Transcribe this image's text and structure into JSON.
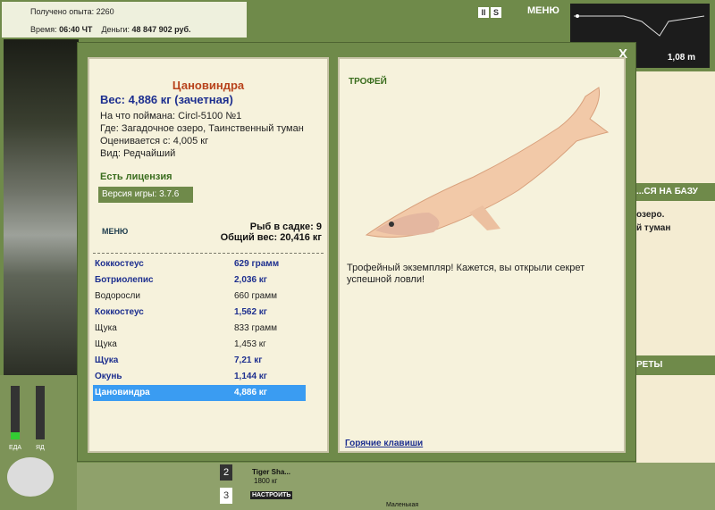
{
  "top_status": {
    "xp_label": "Получено опыта:",
    "xp_value": "2260",
    "time_label": "Время:",
    "time_value": "06:40 ЧТ",
    "money_label": "Деньги:",
    "money_value": "48 847 902 руб."
  },
  "top_controls": {
    "pause": "II",
    "s": "S",
    "menu": "МЕНЮ"
  },
  "depth": {
    "value": "1,08 m"
  },
  "right_panel": {
    "base": "...СЯ НА БАЗУ",
    "lake": "озеро.",
    "fog": "й туман",
    "secrets": "РЕТЫ"
  },
  "bottom": {
    "eat": "ЕДА",
    "poison": "ЯД",
    "n2": "2",
    "n3": "3",
    "lure": "Tiger Sha...",
    "lure_depth": "1800 кг",
    "configure": "НАСТРОИТЬ",
    "small": "Маленькая"
  },
  "dialog": {
    "close": "X",
    "fish_name": "Цановиндра",
    "weight": "Вес: 4,886 кг (зачетная)",
    "caught_with": "На что поймана: Circl-5100 №1",
    "where": "Где: Загадочное озеро, Таинственный туман",
    "value": "Оценивается с: 4,005 кг",
    "kind": "Вид: Редчайший",
    "license": "Есть лицензия",
    "version": "Версия игры: 3.7.6",
    "menu": "МЕНЮ",
    "cage_count": "Рыб в садке: 9",
    "total_weight": "Общий вес: 20,416 кг",
    "catch_list": [
      {
        "name": "Коккостеус",
        "weight": "629 грамм",
        "style": "bold"
      },
      {
        "name": "Ботриолепис",
        "weight": "2,036 кг",
        "style": "bold"
      },
      {
        "name": "Водоросли",
        "weight": "660 грамм",
        "style": "plain"
      },
      {
        "name": "Коккостеус",
        "weight": "1,562 кг",
        "style": "bold"
      },
      {
        "name": "Щука",
        "weight": "833 грамм",
        "style": "plain"
      },
      {
        "name": "Щука",
        "weight": "1,453 кг",
        "style": "plain"
      },
      {
        "name": "Щука",
        "weight": "7,21 кг",
        "style": "bold"
      },
      {
        "name": "Окунь",
        "weight": "1,144 кг",
        "style": "bold"
      },
      {
        "name": "Цановиндра",
        "weight": "4,886 кг",
        "style": "selected"
      }
    ],
    "trophy": "ТРОФЕЙ",
    "description": "Трофейный экземпляр! Кажется, вы открыли секрет успешной ловли!",
    "hotkeys": "Горячие клавиши"
  }
}
